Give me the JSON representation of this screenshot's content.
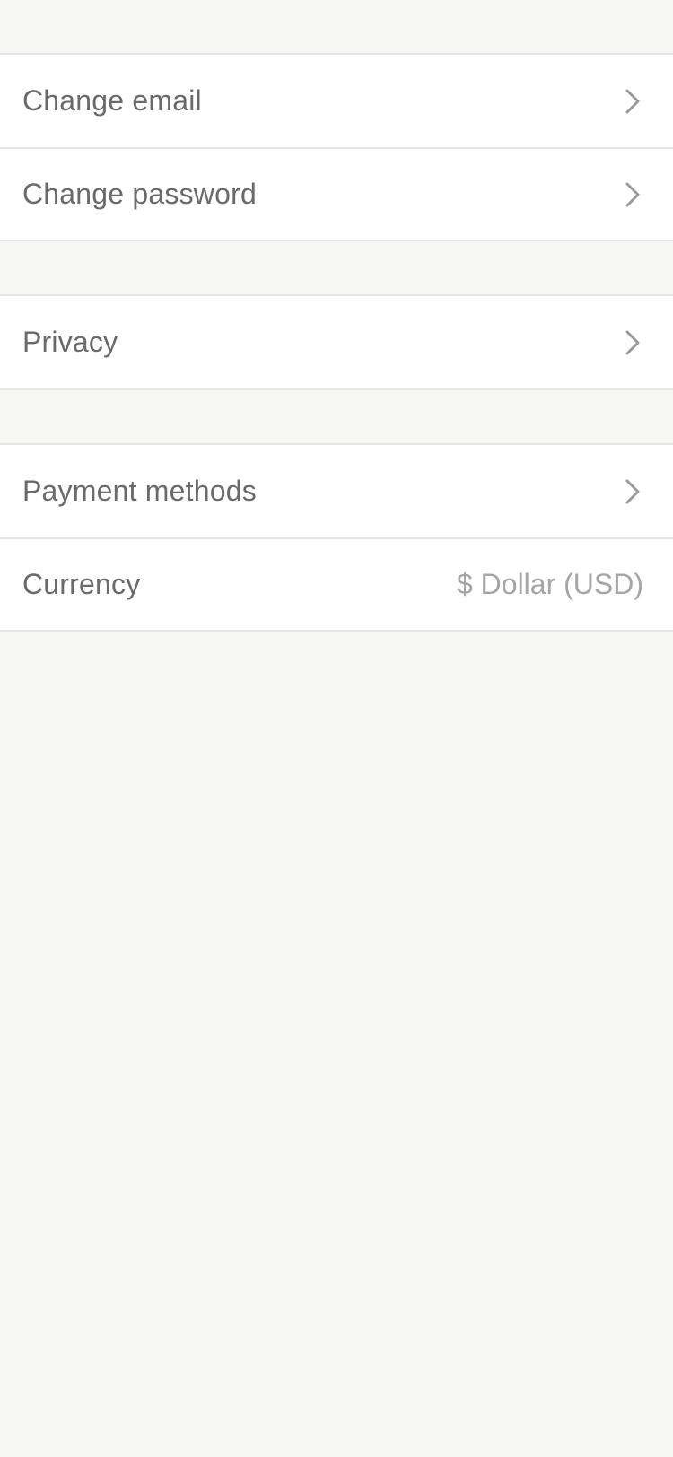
{
  "settings": {
    "groups": [
      {
        "items": [
          {
            "label": "Change email",
            "icon": "chevron-right-icon"
          },
          {
            "label": "Change password",
            "icon": "chevron-right-icon"
          }
        ]
      },
      {
        "items": [
          {
            "label": "Privacy",
            "icon": "chevron-right-icon"
          }
        ]
      },
      {
        "items": [
          {
            "label": "Payment methods",
            "icon": "chevron-right-icon"
          },
          {
            "label": "Currency",
            "value": "$ Dollar (USD)"
          }
        ]
      }
    ]
  },
  "colors": {
    "background": "#f6f6f5",
    "row_background": "#ffffff",
    "label_text": "#6a6a6a",
    "value_text": "#a5a5a5",
    "separator": "#e6e6e6",
    "chevron": "#9a9a9a"
  }
}
